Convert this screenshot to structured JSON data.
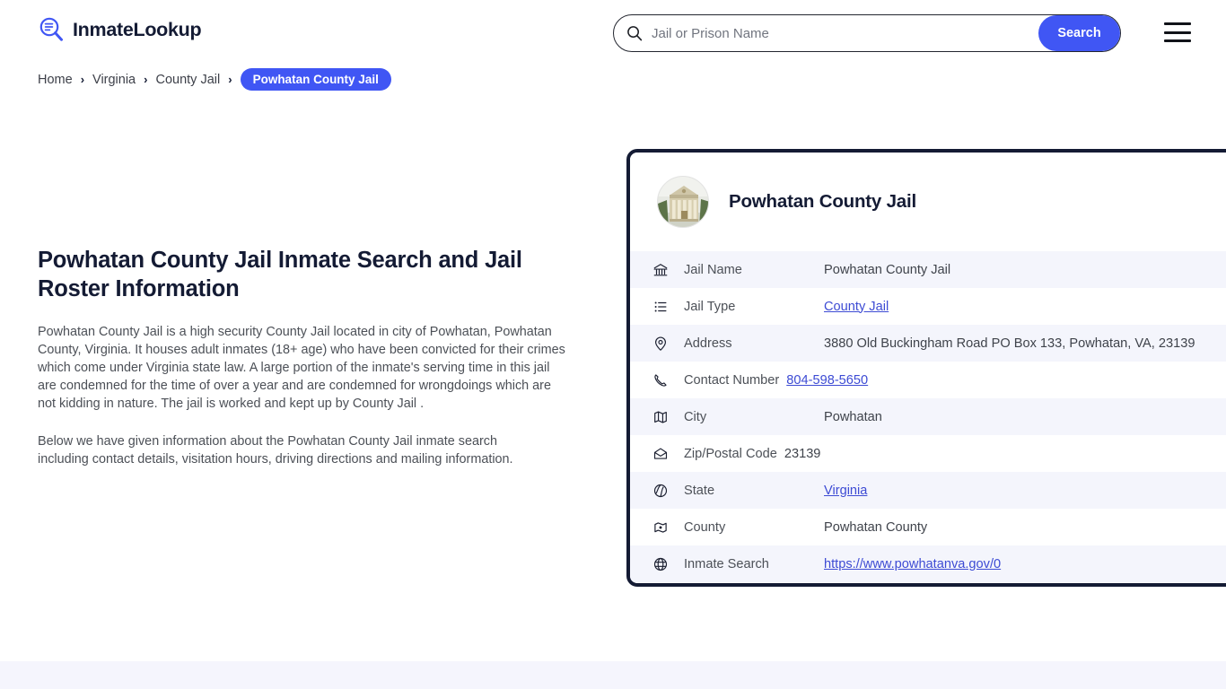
{
  "header": {
    "brand_name": "InmateLookup",
    "brand_icon": "magnifier-list-icon",
    "search": {
      "placeholder": "Jail or Prison Name",
      "value": "",
      "icon": "search-icon",
      "button_label": "Search"
    },
    "menu_icon": "hamburger-menu-icon"
  },
  "breadcrumb": {
    "items": [
      {
        "label": "Home"
      },
      {
        "label": "Virginia"
      },
      {
        "label": "County Jail"
      }
    ],
    "separator": "›",
    "current": "Powhatan County Jail"
  },
  "main": {
    "title": "Powhatan County Jail Inmate Search and Jail Roster Information",
    "paragraph1": "Powhatan County Jail is a high security County Jail located in city of Powhatan, Powhatan County, Virginia. It houses adult inmates (18+ age) who have been convicted for their crimes which come under Virginia state law. A large portion of the inmate's serving time in this jail are condemned for the time of over a year and are condemned for wrongdoings which are not kidding in nature. The jail is worked and kept up by County Jail .",
    "paragraph2": "Below we have given information about the Powhatan County Jail inmate search including contact details, visitation hours, driving directions and mailing information."
  },
  "card": {
    "title": "Powhatan County Jail",
    "thumbnail_icon": "courthouse-photo",
    "rows": [
      {
        "icon": "bank-icon",
        "label": "Jail Name",
        "value": "Powhatan County Jail",
        "link": false
      },
      {
        "icon": "list-icon",
        "label": "Jail Type",
        "value": "County Jail",
        "link": true
      },
      {
        "icon": "map-pin-icon",
        "label": "Address",
        "value": "3880 Old Buckingham Road PO Box 133, Powhatan, VA, 23139",
        "link": false
      },
      {
        "icon": "phone-icon",
        "label": "Contact Number",
        "value": "804-598-5650",
        "link": true
      },
      {
        "icon": "map-icon",
        "label": "City",
        "value": "Powhatan",
        "link": false
      },
      {
        "icon": "envelope-icon",
        "label": "Zip/Postal Code",
        "value": "23139",
        "link": false
      },
      {
        "icon": "compass-icon",
        "label": "State",
        "value": "Virginia",
        "link": true
      },
      {
        "icon": "region-icon",
        "label": "County",
        "value": "Powhatan County",
        "link": false
      },
      {
        "icon": "globe-icon",
        "label": "Inmate Search",
        "value": "https://www.powhatanva.gov/0",
        "link": true
      }
    ]
  },
  "colors": {
    "accent": "#4056f4",
    "ink": "#141b34",
    "link": "#3d4bd4",
    "row_alt": "#f4f5fc",
    "footer_band": "#f5f5fd"
  }
}
